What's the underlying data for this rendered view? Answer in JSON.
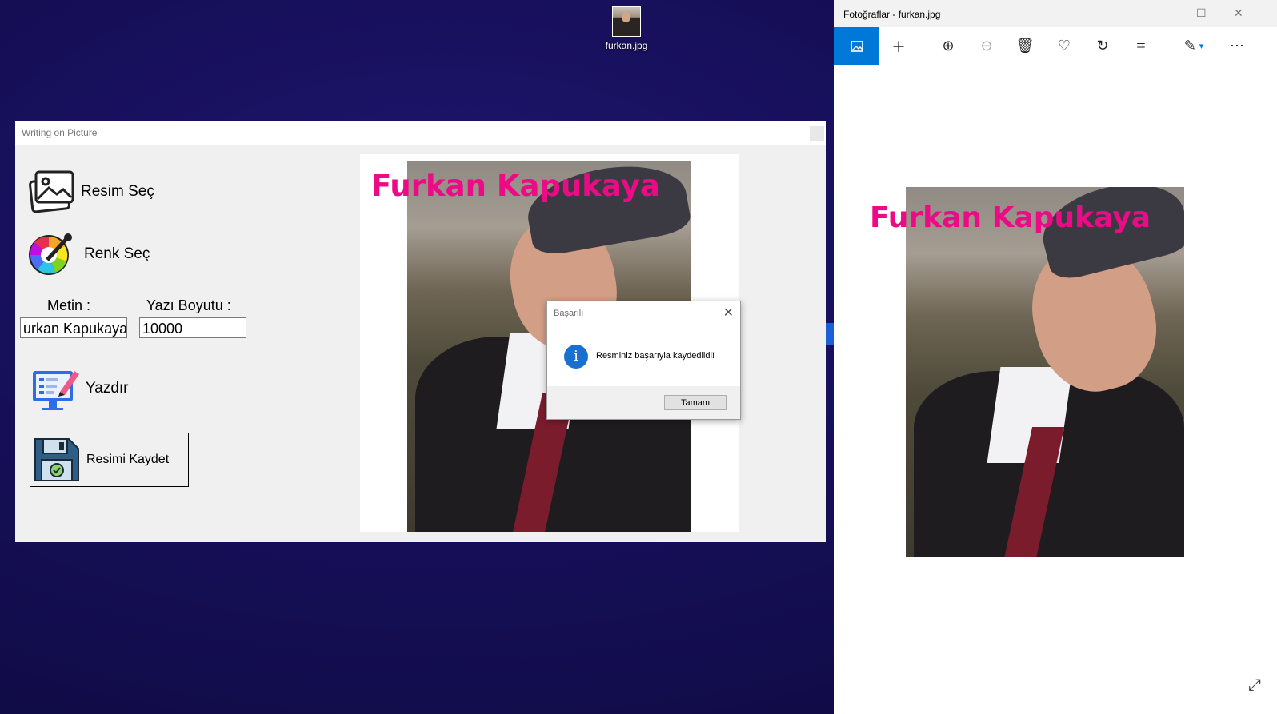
{
  "desktop": {
    "icon_label": "furkan.jpg"
  },
  "writing_window": {
    "title": "Writing on Picture",
    "buttons": {
      "select_image": "Resim Seç",
      "select_color": "Renk Seç",
      "print": "Yazdır",
      "save_image": "Resimi Kaydet"
    },
    "text_label": "Metin :",
    "text_value": "urkan Kapukaya",
    "size_label": "Yazı Boyutu :",
    "size_value": "10000",
    "overlay_text": "Furkan Kapukaya",
    "overlay_color": "#ec0b86"
  },
  "message_box": {
    "title": "Başarılı",
    "message": "Resminiz başarıyla kaydedildi!",
    "ok_label": "Tamam",
    "icon": "info-icon"
  },
  "photos_app": {
    "title": "Fotoğraflar - furkan.jpg",
    "overlay_text": "Furkan Kapukaya",
    "toolbar_icons": [
      "image-icon",
      "add-icon",
      "zoom-in-icon",
      "zoom-out-icon",
      "delete-icon",
      "heart-icon",
      "rotate-icon",
      "crop-icon",
      "edit-icon",
      "more-icon"
    ],
    "accent": "#0078d7"
  }
}
